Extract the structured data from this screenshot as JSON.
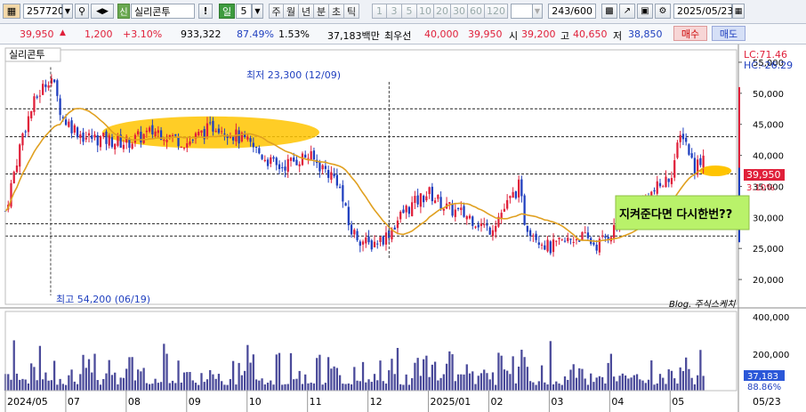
{
  "toolbar": {
    "code": "257720",
    "badge": "신",
    "name": "실리콘투",
    "exclaim": "!",
    "period_label": "일",
    "period_value": "5",
    "periods": [
      "주",
      "월",
      "년",
      "분",
      "초",
      "틱"
    ],
    "intervals": [
      "1",
      "3",
      "5",
      "10",
      "20",
      "30",
      "60",
      "120"
    ],
    "count": "243/600",
    "date": "2025/05/23"
  },
  "quote": {
    "price": "39,950",
    "change": "1,200",
    "change_pct": "+3.10%",
    "volume": "933,322",
    "vol_ratio": "87.49%",
    "turnover_rate": "1.53%",
    "trade_value": "37,183백만",
    "priority_label": "최우선",
    "ask": "40,000",
    "bid": "39,950",
    "open_label": "시",
    "open": "39,200",
    "high_label": "고",
    "high": "40,650",
    "low_label": "저",
    "low": "38,850",
    "buy_button": "매수",
    "sell_button": "매도"
  },
  "colors": {
    "up": "#e0203a",
    "down": "#1f3fbf",
    "ma": "#e0a020",
    "volume": "#4a4a9a",
    "highlight": "#ffc400",
    "annotation_bg": "#b9f26a"
  },
  "chart_data": {
    "type": "candlestick",
    "title": "실리콘투",
    "indicator_labels": [
      "LC:71.46",
      "HC:-26.29"
    ],
    "y_ticks": [
      20000,
      25000,
      30000,
      35000,
      40000,
      45000,
      50000,
      55000
    ],
    "y_tick_labels": [
      "20,000",
      "25,000",
      "30,000",
      "35,000",
      "40,000",
      "45,000",
      "50,000",
      "55,000"
    ],
    "x_ticks": [
      "2024/05",
      "07",
      "08",
      "09",
      "10",
      "11",
      "12",
      "2025/01",
      "02",
      "03",
      "04",
      "05"
    ],
    "x_end_label": "05/23",
    "annotations": {
      "low": "최저 23,300 (12/09)",
      "high": "최고 54,200 (06/19)",
      "note": "지켜준다면 다시한번??",
      "watermark": "Blog. 주식스케치"
    },
    "horizontal_levels": [
      47500,
      43000,
      37000,
      29000,
      27000
    ],
    "current_price_label": "39,950",
    "current_pct_label": "3.10%",
    "last_price": 39950,
    "high_point": 54200,
    "low_point": 23300,
    "volume_axis_ticks": [
      "400,000",
      "200,000"
    ],
    "volume_last_label": "37,183",
    "volume_pct_label": "88.86%",
    "anchors": [
      {
        "m": 0,
        "p": 31000
      },
      {
        "m": 0.3,
        "p": 44000
      },
      {
        "m": 0.5,
        "p": 49000
      },
      {
        "m": 0.75,
        "p": 53000
      },
      {
        "m": 0.95,
        "p": 46000
      },
      {
        "m": 1.3,
        "p": 43000
      },
      {
        "m": 2.0,
        "p": 42000
      },
      {
        "m": 2.5,
        "p": 44000
      },
      {
        "m": 3.0,
        "p": 42000
      },
      {
        "m": 3.5,
        "p": 45000
      },
      {
        "m": 4.0,
        "p": 42000
      },
      {
        "m": 4.5,
        "p": 38000
      },
      {
        "m": 5.0,
        "p": 40000
      },
      {
        "m": 5.5,
        "p": 36000
      },
      {
        "m": 5.7,
        "p": 28000
      },
      {
        "m": 6.0,
        "p": 25500
      },
      {
        "m": 6.3,
        "p": 27000
      },
      {
        "m": 6.6,
        "p": 31000
      },
      {
        "m": 7.0,
        "p": 34000
      },
      {
        "m": 7.3,
        "p": 31500
      },
      {
        "m": 7.7,
        "p": 30000
      },
      {
        "m": 8.0,
        "p": 28000
      },
      {
        "m": 8.3,
        "p": 32000
      },
      {
        "m": 8.5,
        "p": 35000
      },
      {
        "m": 8.6,
        "p": 29000
      },
      {
        "m": 9.0,
        "p": 25000
      },
      {
        "m": 9.5,
        "p": 27000
      },
      {
        "m": 9.8,
        "p": 25500
      },
      {
        "m": 10.0,
        "p": 27500
      },
      {
        "m": 10.3,
        "p": 30000
      },
      {
        "m": 10.6,
        "p": 33000
      },
      {
        "m": 11.0,
        "p": 36500
      },
      {
        "m": 11.2,
        "p": 44000
      },
      {
        "m": 11.4,
        "p": 38000
      },
      {
        "m": 11.55,
        "p": 39950
      }
    ]
  }
}
